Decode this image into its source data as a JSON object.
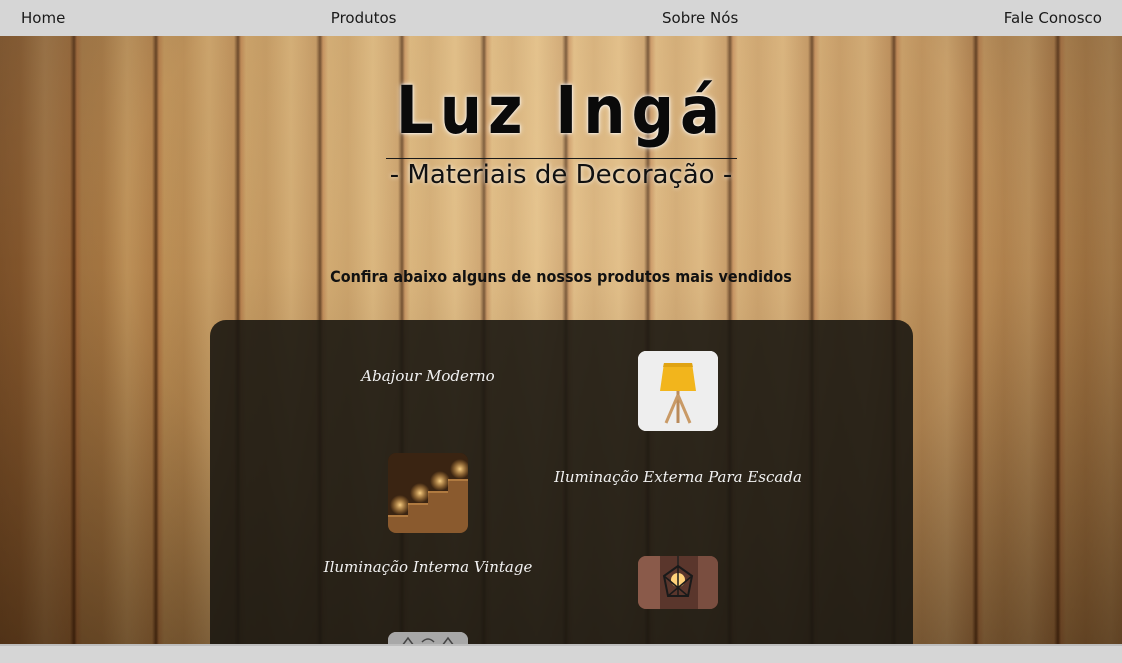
{
  "nav": {
    "home": "Home",
    "products": "Produtos",
    "about": "Sobre Nós",
    "contact": "Fale Conosco"
  },
  "header": {
    "title": "Luz Ingá",
    "subtitle": "- Materiais de Decoração -"
  },
  "intro": "Confira abaixo alguns de nossos produtos mais vendidos",
  "products": [
    {
      "name": "Abajour Moderno",
      "icon": "yellow-tripod-lamp"
    },
    {
      "name": "Iluminação Externa Para Escada",
      "icon": "lit-stairs"
    },
    {
      "name": "Iluminação Interna Vintage",
      "icon": "geometric-pendant-lamp"
    }
  ],
  "colors": {
    "navbar": "#d6d6d6",
    "panel": "#1c1812",
    "product_text": "#f2f2f2"
  }
}
